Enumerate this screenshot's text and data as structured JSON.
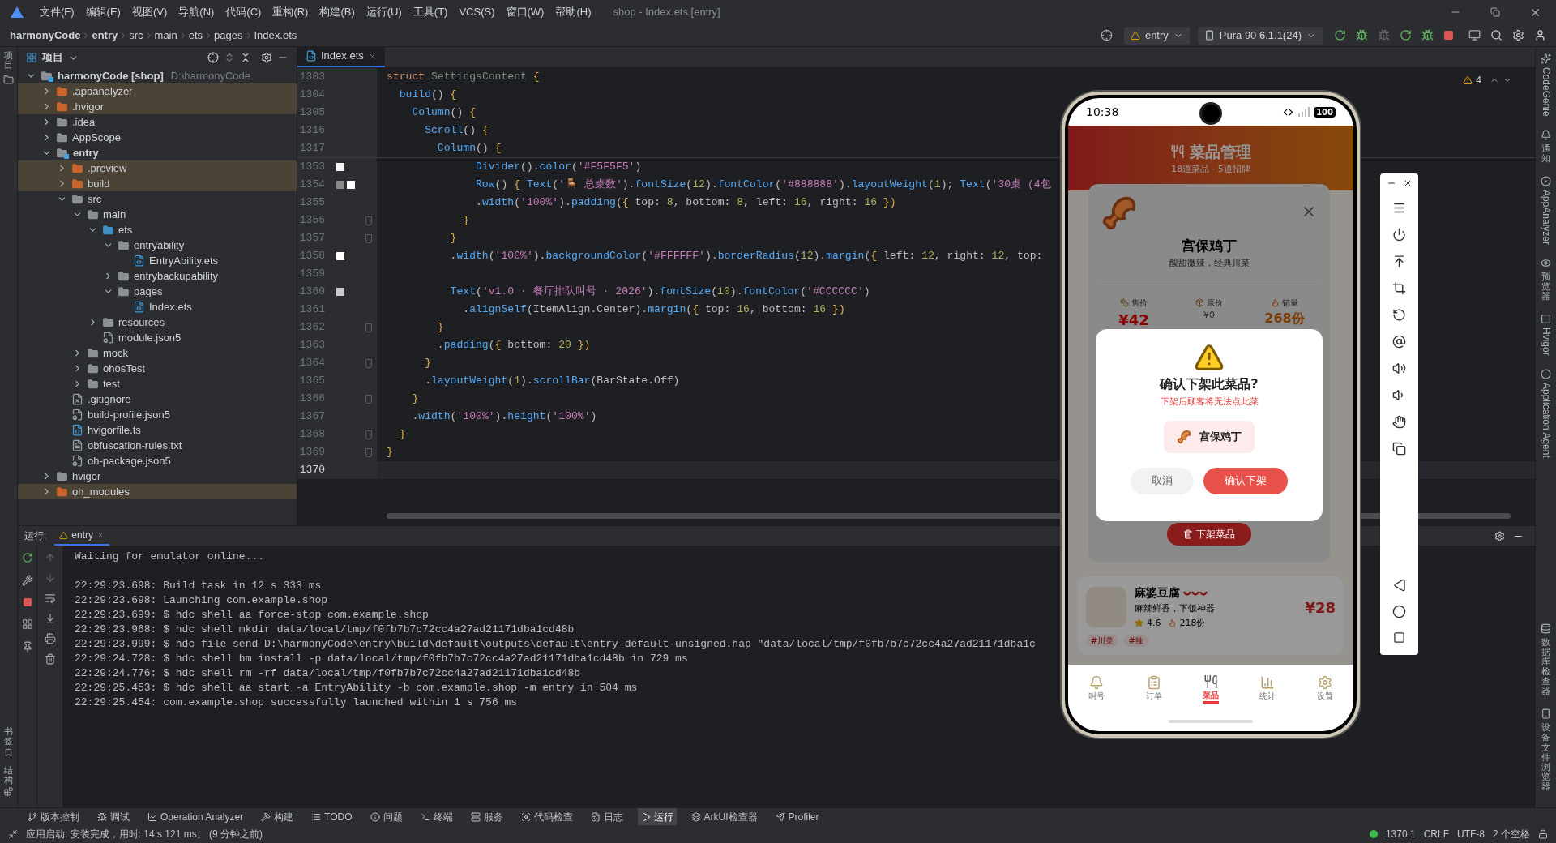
{
  "window": {
    "title": "shop - Index.ets [entry]",
    "menu": [
      "文件(F)",
      "编辑(E)",
      "视图(V)",
      "导航(N)",
      "代码(C)",
      "重构(R)",
      "构建(B)",
      "运行(U)",
      "工具(T)",
      "VCS(S)",
      "窗口(W)",
      "帮助(H)"
    ]
  },
  "breadcrumb": [
    "harmonyCode",
    "entry",
    "src",
    "main",
    "ets",
    "pages",
    "Index.ets"
  ],
  "toolbar": {
    "run_config": "entry",
    "device": "Pura 90 6.1.1(24)"
  },
  "left_strip": {
    "top": [
      "项目"
    ],
    "bottom": [
      "书签",
      "结构"
    ]
  },
  "right_strip": {
    "top": [
      {
        "label": "CodeGenie",
        "kind": "latin"
      },
      {
        "label": "通知",
        "kind": "cjk"
      },
      {
        "label": "AppAnalyzer",
        "kind": "latin"
      },
      {
        "label": "预览器",
        "kind": "cjk"
      },
      {
        "label": "Hvigor",
        "kind": "latin"
      },
      {
        "label": "Application Agent",
        "kind": "latin"
      }
    ],
    "bottom": [
      {
        "label": "数据库检查器",
        "kind": "cjk"
      },
      {
        "label": "设备文件浏览器",
        "kind": "cjk"
      }
    ]
  },
  "project": {
    "title": "项目",
    "tree": [
      {
        "name": "harmonyCode **[shop]**",
        "path": "D:\\harmonyCode",
        "kind": "module",
        "expanded": true,
        "excluded": false,
        "children": [
          {
            "name": ".appanalyzer",
            "kind": "folder",
            "expanded": false,
            "excluded": true
          },
          {
            "name": ".hvigor",
            "kind": "folder",
            "expanded": false,
            "excluded": true
          },
          {
            "name": ".idea",
            "kind": "folder",
            "expanded": false,
            "excluded": false
          },
          {
            "name": "AppScope",
            "kind": "folder",
            "expanded": false,
            "excluded": false
          },
          {
            "name": "entry",
            "kind": "module",
            "expanded": true,
            "excluded": false,
            "children": [
              {
                "name": ".preview",
                "kind": "folder",
                "expanded": false,
                "excluded": true
              },
              {
                "name": "build",
                "kind": "folder",
                "expanded": false,
                "excluded": true
              },
              {
                "name": "src",
                "kind": "folder",
                "expanded": true,
                "excluded": false,
                "children": [
                  {
                    "name": "main",
                    "kind": "folder",
                    "expanded": true,
                    "excluded": false,
                    "children": [
                      {
                        "name": "ets",
                        "kind": "source",
                        "expanded": true,
                        "excluded": false,
                        "children": [
                          {
                            "name": "entryability",
                            "kind": "folder",
                            "expanded": true,
                            "excluded": false,
                            "children": [
                              {
                                "name": "EntryAbility.ets",
                                "kind": "ets",
                                "excluded": false
                              }
                            ]
                          },
                          {
                            "name": "entrybackupability",
                            "kind": "folder",
                            "expanded": false,
                            "excluded": false
                          },
                          {
                            "name": "pages",
                            "kind": "folder",
                            "expanded": true,
                            "excluded": false,
                            "children": [
                              {
                                "name": "Index.ets",
                                "kind": "ets",
                                "excluded": false
                              }
                            ]
                          }
                        ]
                      },
                      {
                        "name": "resources",
                        "kind": "folder",
                        "expanded": false,
                        "excluded": false
                      },
                      {
                        "name": "module.json5",
                        "kind": "json",
                        "excluded": false
                      }
                    ]
                  },
                  {
                    "name": "mock",
                    "kind": "folder",
                    "expanded": false,
                    "excluded": false
                  },
                  {
                    "name": "ohosTest",
                    "kind": "folder",
                    "expanded": false,
                    "excluded": false
                  },
                  {
                    "name": "test",
                    "kind": "folder",
                    "expanded": false,
                    "excluded": false
                  }
                ]
              },
              {
                "name": ".gitignore",
                "kind": "ignore",
                "excluded": false
              },
              {
                "name": "build-profile.json5",
                "kind": "json",
                "excluded": false
              },
              {
                "name": "hvigorfile.ts",
                "kind": "ts",
                "excluded": false
              },
              {
                "name": "obfuscation-rules.txt",
                "kind": "txt",
                "excluded": false
              },
              {
                "name": "oh-package.json5",
                "kind": "json",
                "excluded": false
              }
            ]
          },
          {
            "name": "hvigor",
            "kind": "folder",
            "expanded": false,
            "excluded": false
          },
          {
            "name": "oh_modules",
            "kind": "folder",
            "expanded": false,
            "excluded": true
          }
        ]
      }
    ]
  },
  "editor": {
    "tab": "Index.ets",
    "warnings": "4",
    "sticky_lines": [
      {
        "number": "1303",
        "tokens": [
          {
            "kind": "keyword",
            "text": "struct "
          },
          {
            "kind": "type",
            "text": "SettingsContent "
          },
          {
            "kind": "brace",
            "text": "{"
          }
        ]
      },
      {
        "number": "1304",
        "tokens": [
          {
            "kind": "method",
            "text": "  build"
          },
          {
            "kind": "plain",
            "text": "() "
          },
          {
            "kind": "brace",
            "text": "{"
          }
        ]
      },
      {
        "number": "1305",
        "tokens": [
          {
            "kind": "method",
            "text": "    Column"
          },
          {
            "kind": "plain",
            "text": "() "
          },
          {
            "kind": "brace",
            "text": "{"
          }
        ]
      },
      {
        "number": "1316",
        "tokens": [
          {
            "kind": "method",
            "text": "      Scroll"
          },
          {
            "kind": "plain",
            "text": "() "
          },
          {
            "kind": "brace",
            "text": "{"
          }
        ]
      },
      {
        "number": "1317",
        "tokens": [
          {
            "kind": "method",
            "text": "        Column"
          },
          {
            "kind": "plain",
            "text": "() "
          },
          {
            "kind": "brace",
            "text": "{"
          }
        ]
      }
    ],
    "lines": [
      {
        "number": "1353",
        "current": false,
        "fold": false,
        "swatches": [
          {
            "color": "#F5F5F5"
          }
        ],
        "tokens": [
          {
            "kind": "method",
            "text": "              Divider"
          },
          {
            "kind": "plain",
            "text": "()."
          },
          {
            "kind": "method",
            "text": "color"
          },
          {
            "kind": "plain",
            "text": "("
          },
          {
            "kind": "string",
            "text": "'#F5F5F5'"
          },
          {
            "kind": "plain",
            "text": ")"
          }
        ]
      },
      {
        "number": "1354",
        "current": false,
        "fold": false,
        "swatches": [
          {
            "color": "#888888"
          },
          {
            "color": "#FFFFFF"
          }
        ],
        "tokens": [
          {
            "kind": "method",
            "text": "              Row"
          },
          {
            "kind": "plain",
            "text": "() "
          },
          {
            "kind": "brace",
            "text": "{ "
          },
          {
            "kind": "method",
            "text": "Text"
          },
          {
            "kind": "plain",
            "text": "("
          },
          {
            "kind": "string",
            "text": "'🪑 总桌数'"
          },
          {
            "kind": "plain",
            "text": ")."
          },
          {
            "kind": "method",
            "text": "fontSize"
          },
          {
            "kind": "plain",
            "text": "("
          },
          {
            "kind": "number",
            "text": "12"
          },
          {
            "kind": "plain",
            "text": ")."
          },
          {
            "kind": "method",
            "text": "fontColor"
          },
          {
            "kind": "plain",
            "text": "("
          },
          {
            "kind": "string",
            "text": "'#888888'"
          },
          {
            "kind": "plain",
            "text": ")."
          },
          {
            "kind": "method",
            "text": "layoutWeight"
          },
          {
            "kind": "plain",
            "text": "("
          },
          {
            "kind": "number",
            "text": "1"
          },
          {
            "kind": "plain",
            "text": "); "
          },
          {
            "kind": "method",
            "text": "Text"
          },
          {
            "kind": "plain",
            "text": "("
          },
          {
            "kind": "string",
            "text": "'30桌 (4包"
          }
        ]
      },
      {
        "number": "1355",
        "current": false,
        "fold": false,
        "tokens": [
          {
            "kind": "plain",
            "text": "              ."
          },
          {
            "kind": "method",
            "text": "width"
          },
          {
            "kind": "plain",
            "text": "("
          },
          {
            "kind": "string",
            "text": "'100%'"
          },
          {
            "kind": "plain",
            "text": ")."
          },
          {
            "kind": "method",
            "text": "padding"
          },
          {
            "kind": "plain",
            "text": "("
          },
          {
            "kind": "brace",
            "text": "{ "
          },
          {
            "kind": "plain",
            "text": "top: "
          },
          {
            "kind": "number",
            "text": "8"
          },
          {
            "kind": "plain",
            "text": ", bottom: "
          },
          {
            "kind": "number",
            "text": "8"
          },
          {
            "kind": "plain",
            "text": ", left: "
          },
          {
            "kind": "number",
            "text": "16"
          },
          {
            "kind": "plain",
            "text": ", right: "
          },
          {
            "kind": "number",
            "text": "16"
          },
          {
            "kind": "brace",
            "text": " })"
          }
        ]
      },
      {
        "number": "1356",
        "current": false,
        "fold": true,
        "tokens": [
          {
            "kind": "brace",
            "text": "            }"
          }
        ]
      },
      {
        "number": "1357",
        "current": false,
        "fold": true,
        "tokens": [
          {
            "kind": "brace",
            "text": "          }"
          }
        ]
      },
      {
        "number": "1358",
        "current": false,
        "fold": false,
        "swatches": [
          {
            "color": "#FFFFFF"
          }
        ],
        "tokens": [
          {
            "kind": "plain",
            "text": "          ."
          },
          {
            "kind": "method",
            "text": "width"
          },
          {
            "kind": "plain",
            "text": "("
          },
          {
            "kind": "string",
            "text": "'100%'"
          },
          {
            "kind": "plain",
            "text": ")."
          },
          {
            "kind": "method",
            "text": "backgroundColor"
          },
          {
            "kind": "plain",
            "text": "("
          },
          {
            "kind": "string",
            "text": "'#FFFFFF'"
          },
          {
            "kind": "plain",
            "text": ")."
          },
          {
            "kind": "method",
            "text": "borderRadius"
          },
          {
            "kind": "plain",
            "text": "("
          },
          {
            "kind": "number",
            "text": "12"
          },
          {
            "kind": "plain",
            "text": ")."
          },
          {
            "kind": "method",
            "text": "margin"
          },
          {
            "kind": "plain",
            "text": "("
          },
          {
            "kind": "brace",
            "text": "{ "
          },
          {
            "kind": "plain",
            "text": "left: "
          },
          {
            "kind": "number",
            "text": "12"
          },
          {
            "kind": "plain",
            "text": ", right: "
          },
          {
            "kind": "number",
            "text": "12"
          },
          {
            "kind": "plain",
            "text": ", top:"
          }
        ]
      },
      {
        "number": "1359",
        "current": false,
        "fold": false
      },
      {
        "number": "1360",
        "current": false,
        "fold": false,
        "swatches": [
          {
            "color": "#CCCCCC"
          }
        ],
        "tokens": [
          {
            "kind": "method",
            "text": "          Text"
          },
          {
            "kind": "plain",
            "text": "("
          },
          {
            "kind": "string",
            "text": "'v1.0 · 餐厅排队叫号 · 2026'"
          },
          {
            "kind": "plain",
            "text": ")."
          },
          {
            "kind": "method",
            "text": "fontSize"
          },
          {
            "kind": "plain",
            "text": "("
          },
          {
            "kind": "number",
            "text": "10"
          },
          {
            "kind": "plain",
            "text": ")."
          },
          {
            "kind": "method",
            "text": "fontColor"
          },
          {
            "kind": "plain",
            "text": "("
          },
          {
            "kind": "string",
            "text": "'#CCCCCC'"
          },
          {
            "kind": "plain",
            "text": ")"
          }
        ]
      },
      {
        "number": "1361",
        "current": false,
        "fold": false,
        "tokens": [
          {
            "kind": "plain",
            "text": "            ."
          },
          {
            "kind": "method",
            "text": "alignSelf"
          },
          {
            "kind": "plain",
            "text": "(ItemAlign.Center)."
          },
          {
            "kind": "method",
            "text": "margin"
          },
          {
            "kind": "plain",
            "text": "("
          },
          {
            "kind": "brace",
            "text": "{ "
          },
          {
            "kind": "plain",
            "text": "top: "
          },
          {
            "kind": "number",
            "text": "16"
          },
          {
            "kind": "plain",
            "text": ", bottom: "
          },
          {
            "kind": "number",
            "text": "16"
          },
          {
            "kind": "brace",
            "text": " })"
          }
        ]
      },
      {
        "number": "1362",
        "current": false,
        "fold": true,
        "tokens": [
          {
            "kind": "brace",
            "text": "        }"
          }
        ]
      },
      {
        "number": "1363",
        "current": false,
        "fold": false,
        "tokens": [
          {
            "kind": "plain",
            "text": "        ."
          },
          {
            "kind": "method",
            "text": "padding"
          },
          {
            "kind": "plain",
            "text": "("
          },
          {
            "kind": "brace",
            "text": "{ "
          },
          {
            "kind": "plain",
            "text": "bottom: "
          },
          {
            "kind": "number",
            "text": "20"
          },
          {
            "kind": "brace",
            "text": " })"
          }
        ]
      },
      {
        "number": "1364",
        "current": false,
        "fold": true,
        "tokens": [
          {
            "kind": "brace",
            "text": "      }"
          }
        ]
      },
      {
        "number": "1365",
        "current": false,
        "fold": false,
        "tokens": [
          {
            "kind": "plain",
            "text": "      ."
          },
          {
            "kind": "method",
            "text": "layoutWeight"
          },
          {
            "kind": "plain",
            "text": "("
          },
          {
            "kind": "number",
            "text": "1"
          },
          {
            "kind": "plain",
            "text": ")."
          },
          {
            "kind": "method",
            "text": "scrollBar"
          },
          {
            "kind": "plain",
            "text": "(BarState.Off)"
          }
        ]
      },
      {
        "number": "1366",
        "current": false,
        "fold": true,
        "tokens": [
          {
            "kind": "brace",
            "text": "    }"
          }
        ]
      },
      {
        "number": "1367",
        "current": false,
        "fold": false,
        "tokens": [
          {
            "kind": "plain",
            "text": "    ."
          },
          {
            "kind": "method",
            "text": "width"
          },
          {
            "kind": "plain",
            "text": "("
          },
          {
            "kind": "string",
            "text": "'100%'"
          },
          {
            "kind": "plain",
            "text": ")."
          },
          {
            "kind": "method",
            "text": "height"
          },
          {
            "kind": "plain",
            "text": "("
          },
          {
            "kind": "string",
            "text": "'100%'"
          },
          {
            "kind": "plain",
            "text": ")"
          }
        ]
      },
      {
        "number": "1368",
        "current": false,
        "fold": true,
        "tokens": [
          {
            "kind": "brace",
            "text": "  }"
          }
        ]
      },
      {
        "number": "1369",
        "current": false,
        "fold": true,
        "tokens": [
          {
            "kind": "brace",
            "text": "}"
          }
        ]
      },
      {
        "number": "1370",
        "current": true,
        "fold": false
      }
    ]
  },
  "run": {
    "label": "运行:",
    "tab": "entry",
    "console": [
      "Waiting for emulator online...",
      "22:29:23.698: Build task in 12 s 333 ms",
      "22:29:23.698: Launching com.example.shop",
      "22:29:23.699: $ hdc shell aa force-stop com.example.shop",
      "22:29:23.968: $ hdc shell mkdir data/local/tmp/f0fb7b7c72cc4a27ad21171dba1cd48b",
      "22:29:23.999: $ hdc file send D:\\harmonyCode\\entry\\build\\default\\outputs\\default\\entry-default-unsigned.hap \"data/local/tmp/f0fb7b7c72cc4a27ad21171dba1c",
      "22:29:24.728: $ hdc shell bm install -p data/local/tmp/f0fb7b7c72cc4a27ad21171dba1cd48b in 729 ms",
      "22:29:24.776: $ hdc shell rm -rf data/local/tmp/f0fb7b7c72cc4a27ad21171dba1cd48b",
      "22:29:25.453: $ hdc shell aa start -a EntryAbility -b com.example.shop -m entry in 504 ms",
      "22:29:25.454: com.example.shop successfully launched within 1 s 756 ms"
    ]
  },
  "phone": {
    "time": "10:38",
    "battery": "100",
    "app": {
      "title": "菜品管理",
      "subtitle": "18道菜品 · 5道招牌",
      "card": {
        "name": "麻婆豆腐",
        "desc": "麻辣鲜香，下饭神器",
        "rating": "4.6",
        "sales": "218份",
        "price": "¥28",
        "tags": [
          "#川菜",
          "#辣"
        ]
      },
      "tabs": [
        {
          "label": "叫号",
          "selected": false
        },
        {
          "label": "订单",
          "selected": false
        },
        {
          "label": "菜品",
          "selected": true
        },
        {
          "label": "统计",
          "selected": false
        },
        {
          "label": "设置",
          "selected": false
        }
      ]
    },
    "sheet": {
      "name": "宫保鸡丁",
      "desc": "酸甜微辣，经典川菜",
      "stats": [
        {
          "label": "售价",
          "value": "¥42",
          "kind": "price"
        },
        {
          "label": "原价",
          "value": "¥0",
          "kind": "original"
        },
        {
          "label": "销量",
          "value": "268份",
          "kind": "sales"
        }
      ],
      "action": "下架菜品"
    },
    "dialog": {
      "title": "确认下架此菜品?",
      "message": "下架后顾客将无法点此菜",
      "dish": "宫保鸡丁",
      "cancel": "取消",
      "confirm": "确认下架"
    }
  },
  "bottom_tabs": [
    {
      "label": "版本控制",
      "selected": false
    },
    {
      "label": "调试",
      "selected": false
    },
    {
      "label": "Operation Analyzer",
      "selected": false
    },
    {
      "label": "构建",
      "selected": false
    },
    {
      "label": "TODO",
      "selected": false
    },
    {
      "label": "问题",
      "selected": false
    },
    {
      "label": "终端",
      "selected": false
    },
    {
      "label": "服务",
      "selected": false
    },
    {
      "label": "代码检查",
      "selected": false
    },
    {
      "label": "日志",
      "selected": false
    },
    {
      "label": "运行",
      "selected": true
    },
    {
      "label": "ArkUI检查器",
      "selected": false
    },
    {
      "label": "Profiler",
      "selected": false
    }
  ],
  "status_bar": {
    "message": "应用启动: 安装完成，用时: 14 s 121 ms。 (9 分钟之前)",
    "position": "1370:1",
    "line_ending": "CRLF",
    "encoding": "UTF-8",
    "indent": "2 个空格"
  }
}
